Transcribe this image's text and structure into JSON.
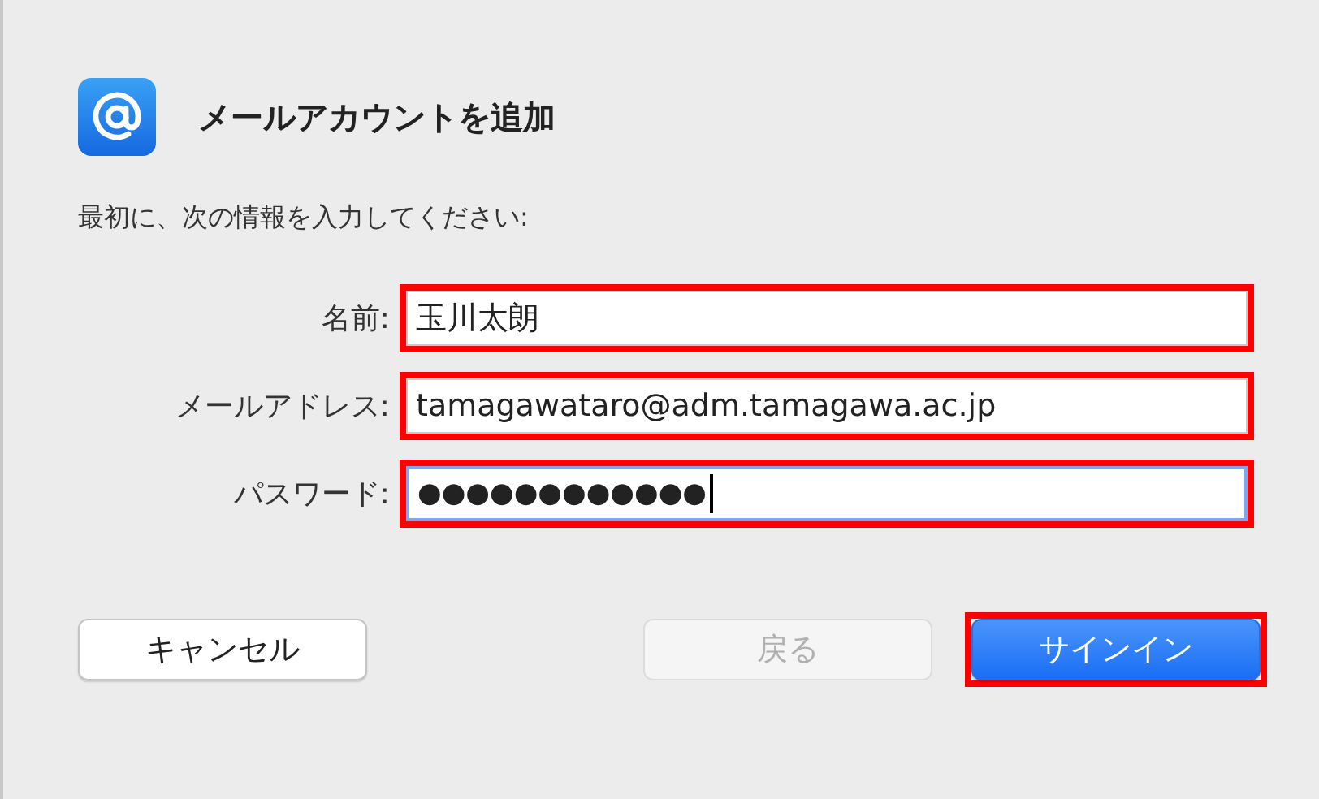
{
  "title": "メールアカウントを追加",
  "instruction": "最初に、次の情報を入力してください:",
  "fields": [
    {
      "label": "名前:",
      "value": "玉川太朗",
      "kind": "text",
      "focused": false,
      "highlighted": true
    },
    {
      "label": "メールアドレス:",
      "value": "tamagawataro@adm.tamagawa.ac.jp",
      "kind": "text",
      "focused": false,
      "highlighted": true
    },
    {
      "label": "パスワード:",
      "value": "●●●●●●●●●●●●",
      "kind": "password",
      "focused": true,
      "highlighted": true
    }
  ],
  "buttons": [
    {
      "label": "キャンセル",
      "kind": "normal",
      "disabled": false,
      "highlighted": false
    },
    {
      "label": "戻る",
      "kind": "normal",
      "disabled": true,
      "highlighted": false
    },
    {
      "label": "サインイン",
      "kind": "default",
      "disabled": false,
      "highlighted": true
    }
  ]
}
